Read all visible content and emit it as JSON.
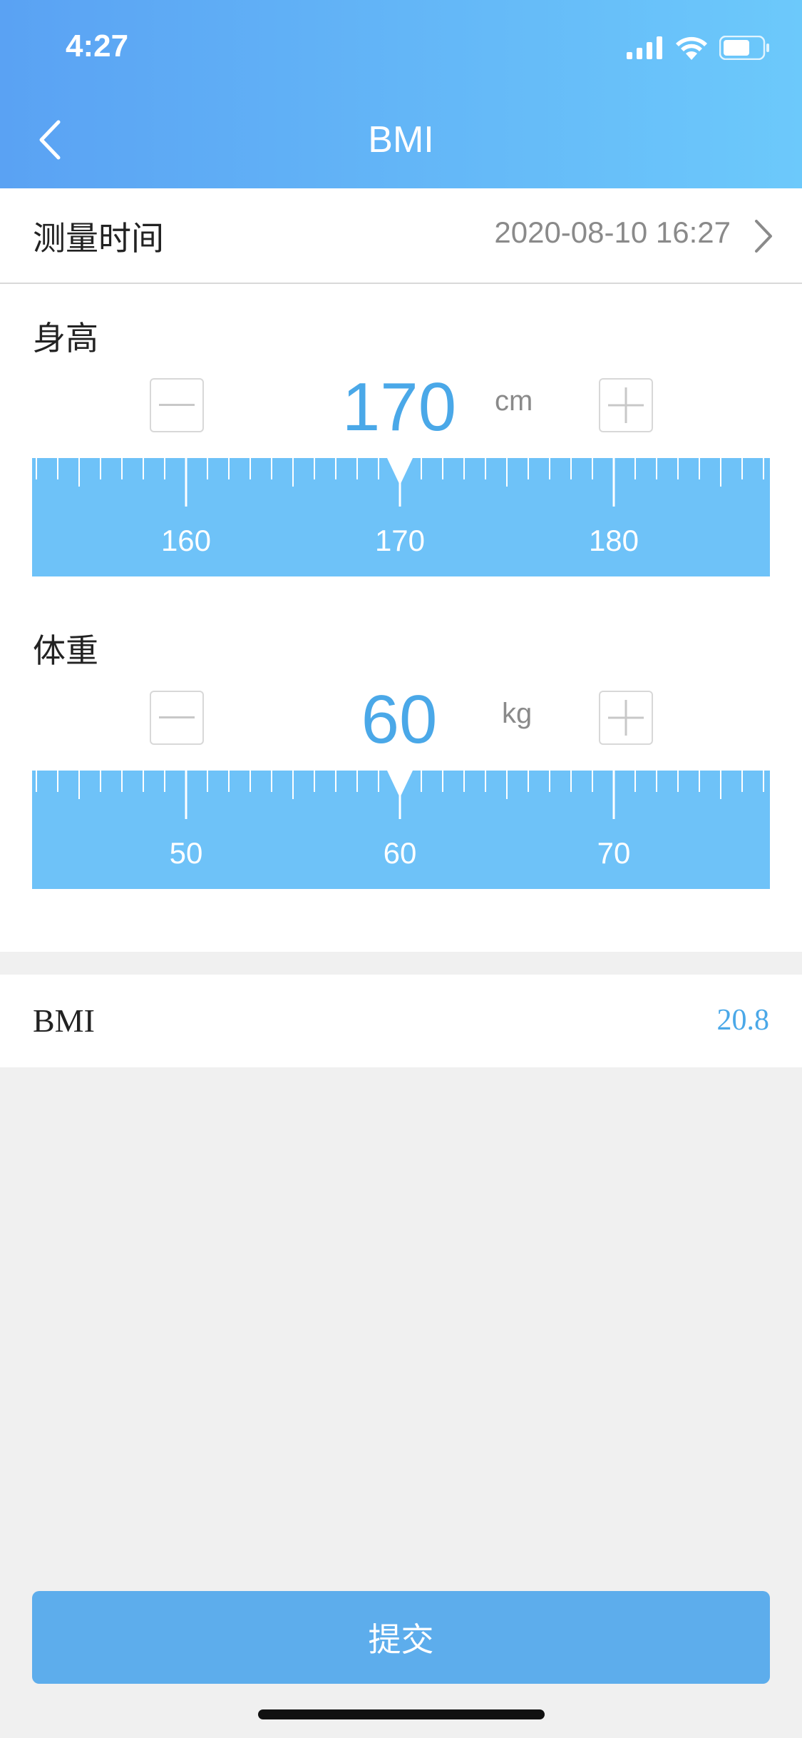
{
  "status_bar": {
    "time": "4:27"
  },
  "nav": {
    "title": "BMI"
  },
  "measure_time": {
    "label": "测量时间",
    "value": "2020-08-10 16:27"
  },
  "height": {
    "title": "身高",
    "value": "170",
    "unit": "cm",
    "ruler_labels": [
      "160",
      "170",
      "180"
    ]
  },
  "weight": {
    "title": "体重",
    "value": "60",
    "unit": "kg",
    "ruler_labels": [
      "50",
      "60",
      "70"
    ]
  },
  "bmi": {
    "label": "BMI",
    "value": "20.8"
  },
  "submit": {
    "label": "提交"
  },
  "colors": {
    "header_start": "#5aa2f3",
    "header_end": "#6cc9fb",
    "accent": "#4aa8e8",
    "ruler": "#6ec2f8",
    "button": "#5dadec"
  }
}
